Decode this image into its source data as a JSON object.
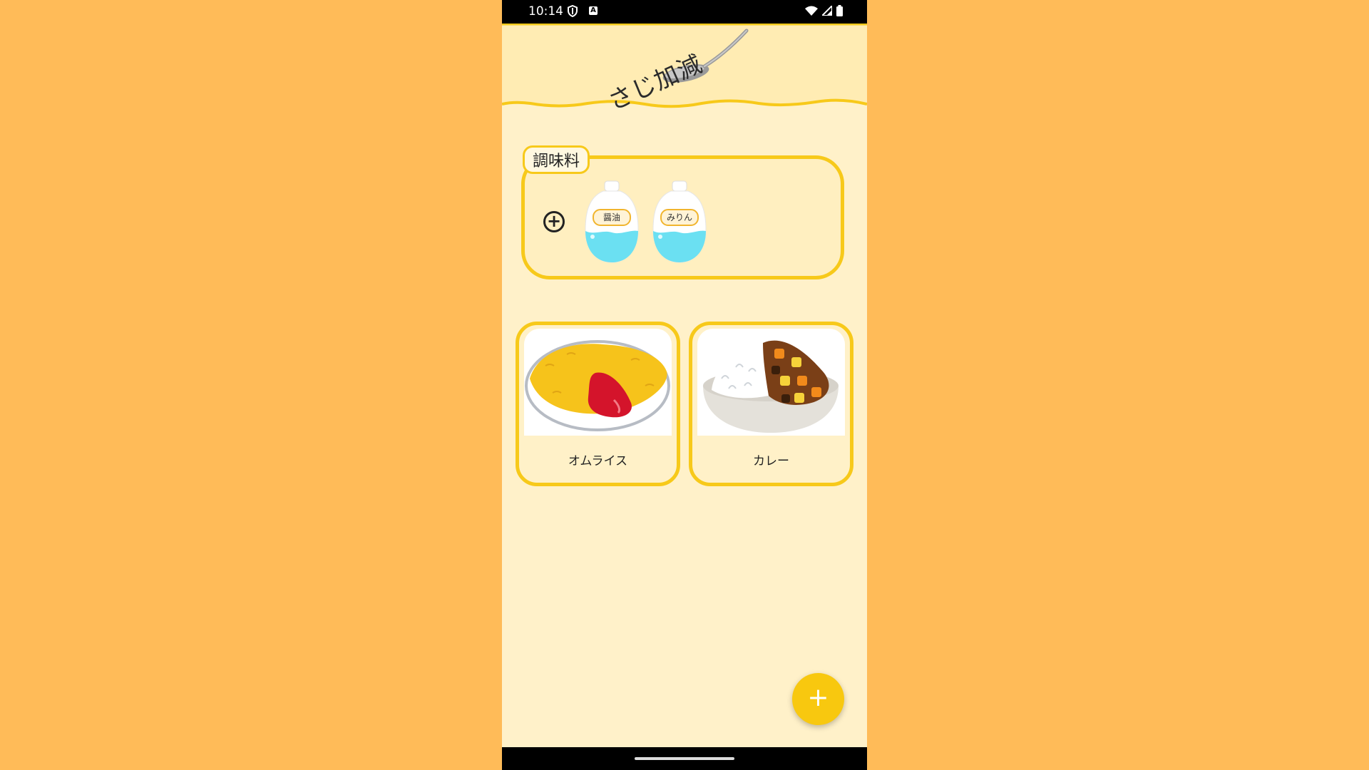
{
  "status_bar": {
    "time": "10:14"
  },
  "header": {
    "title": "さじ加減"
  },
  "seasonings": {
    "section_label": "調味料",
    "items": [
      {
        "label": "醤油"
      },
      {
        "label": "みりん"
      }
    ]
  },
  "recipes": [
    {
      "name": "オムライス"
    },
    {
      "name": "カレー"
    }
  ],
  "colors": {
    "accent": "#F7C91A",
    "background": "#FFBB58",
    "page": "#FFF1C9"
  },
  "fab": {
    "label": "+"
  }
}
